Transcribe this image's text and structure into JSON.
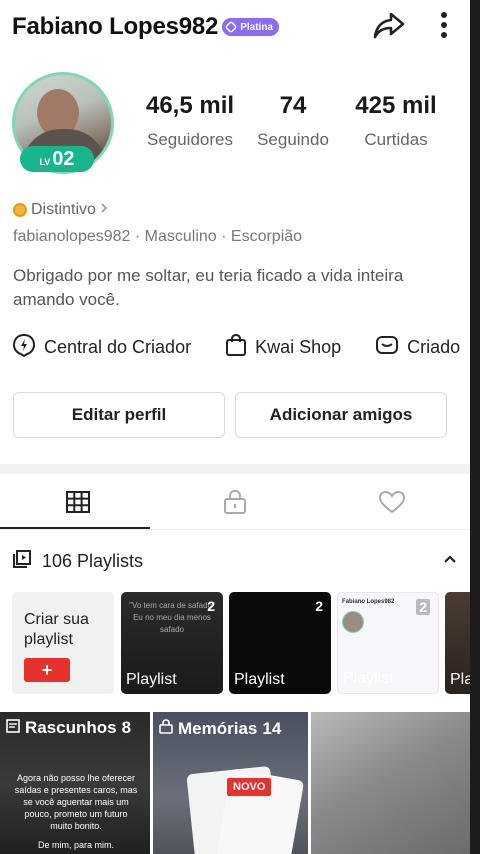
{
  "header": {
    "username": "Fabiano Lopes982",
    "badge": "Platina",
    "icons": [
      "share-icon",
      "more-vertical-icon"
    ]
  },
  "profile": {
    "level_prefix": "LV",
    "level": "02",
    "stats": [
      {
        "value": "46,5 mil",
        "label": "Seguidores"
      },
      {
        "value": "74",
        "label": "Seguindo"
      },
      {
        "value": "425 mil",
        "label": "Curtidas"
      }
    ],
    "distintivo": "Distintivo",
    "meta": "fabianolopes982 · Masculino · Escorpião",
    "bio": "Obrigado por me soltar, eu teria ficado a vida inteira amando você."
  },
  "links": [
    {
      "label": "Central do Criador",
      "icon": "bolt-circle-icon"
    },
    {
      "label": "Kwai Shop",
      "icon": "bag-icon"
    },
    {
      "label": "Criado",
      "icon": "creator-icon"
    }
  ],
  "buttons": {
    "edit": "Editar perfil",
    "add_friends": "Adicionar amigos"
  },
  "tabs": [
    "grid-icon",
    "lock-icon",
    "heart-icon"
  ],
  "playlists": {
    "header": "106 Playlists",
    "create_label": "Criar sua playlist",
    "create_button": "+",
    "cards": [
      {
        "label": "Playlist",
        "count": "2",
        "overlay": "\"Vo tem cara de safado\" Eu no meu dia menos safado"
      },
      {
        "label": "Playlist",
        "count": "2"
      },
      {
        "label": "Playlist",
        "count": "2",
        "overlay": "Fabiano Lopes982"
      },
      {
        "label": "Pla"
      }
    ]
  },
  "tiles": [
    {
      "title": "Rascunhos",
      "count": "8",
      "text": "Agora não posso lhe oferecer saídas e presentes caros, mas se você aguentar mais um pouco, prometo um futuro muito bonito.",
      "signature": "De mim, para mim."
    },
    {
      "title": "Memórias",
      "count": "14",
      "tag": "NOVO"
    },
    {
      "title": ""
    }
  ],
  "colors": {
    "accent_red": "#e5322d",
    "level_green": "#18b48c",
    "badge_purple": "#8b6cf6"
  }
}
